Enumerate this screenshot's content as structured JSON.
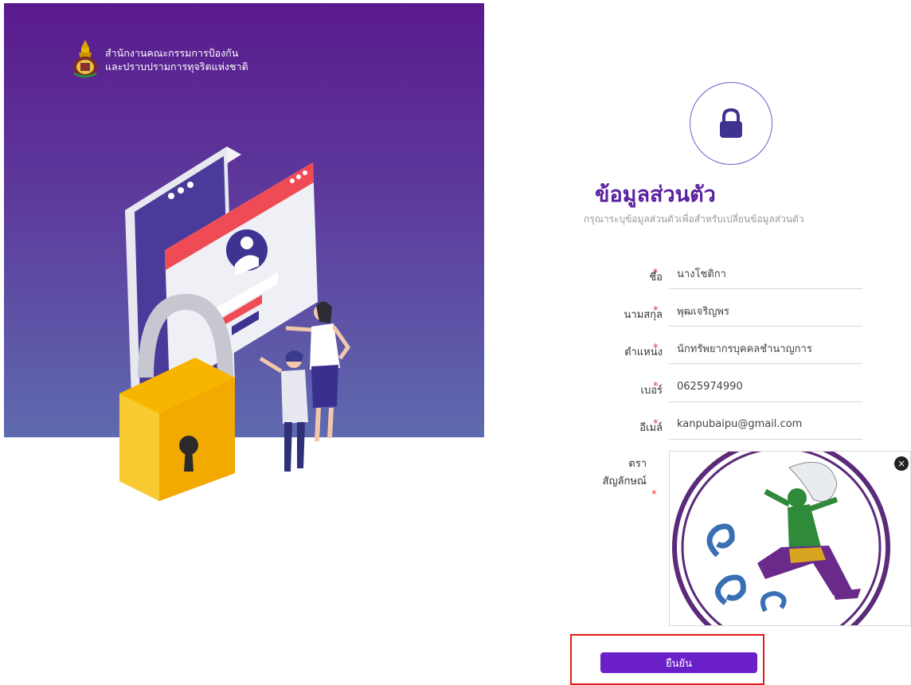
{
  "org": {
    "line1": "สำนักงานคณะกรรมการป้องกัน",
    "line2": "และปราบปรามการทุจริตแห่งชาติ"
  },
  "page": {
    "title": "ข้อมูลส่วนตัว",
    "subtitle": "กรุณาระบุข้อมูลส่วนตัวเพื่อสำหรับเปลี่ยนข้อมูลส่วนตัว"
  },
  "form": {
    "required_mark": "*",
    "fields": [
      {
        "label": "ชื่อ",
        "value": "นางโชติกา"
      },
      {
        "label": "นามสกุล",
        "value": "พุฒเจริญพร"
      },
      {
        "label": "ตำแหน่ง",
        "value": "นักทรัพยากรบุคคลชำนาญการ"
      },
      {
        "label": "เบอร์",
        "value": "0625974990"
      },
      {
        "label": "อีเมล์",
        "value": "kanpubaipu@gmail.com"
      }
    ],
    "emblem_label_1": "ตรา",
    "emblem_label_2": "สัญลักษณ์",
    "remove_icon": "×",
    "confirm_label": "ยืนยัน"
  },
  "colors": {
    "accent": "#6a1fc8",
    "title": "#5a21a0",
    "highlight": "#e21b1b",
    "required": "#e53935"
  }
}
